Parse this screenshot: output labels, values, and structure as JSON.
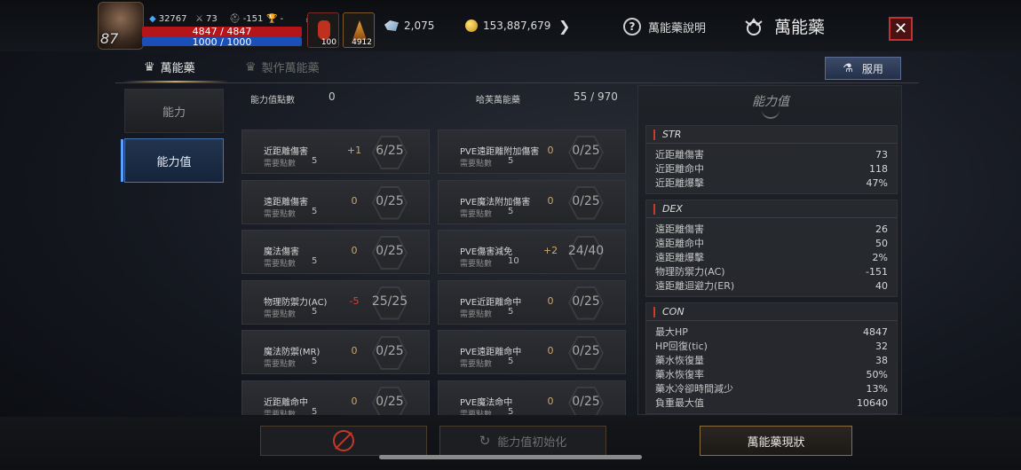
{
  "header": {
    "level": "87",
    "stat_ac": "32767",
    "stat_atk": "73",
    "stat_def": "-151",
    "stat_trophy": "-",
    "hp_text": "4847 / 4847",
    "mp_text": "1000 / 1000",
    "slot1_count": "100",
    "slot2_count": "4912",
    "gems": "2,075",
    "gold": "153,887,679",
    "help_label": "萬能藥說明",
    "title": "萬能藥"
  },
  "tabs": {
    "active": "萬能藥",
    "inactive": "製作萬能藥",
    "use_button": "服用"
  },
  "sidebar": {
    "items": [
      {
        "label": "能力"
      },
      {
        "label": "能力值"
      }
    ]
  },
  "points": {
    "label": "能力值點數",
    "value": "0",
    "halpas_label": "哈芙萬能藥",
    "halpas_value": "55 / 970"
  },
  "req_label": "需要點數",
  "cards_left": [
    {
      "name": "近距離傷害",
      "req": "5",
      "bonus": "+1",
      "value": "6/25"
    },
    {
      "name": "遠距離傷害",
      "req": "5",
      "bonus": "0",
      "value": "0/25"
    },
    {
      "name": "魔法傷害",
      "req": "5",
      "bonus": "0",
      "value": "0/25"
    },
    {
      "name": "物理防禦力(AC)",
      "req": "5",
      "bonus": "-5",
      "value": "25/25"
    },
    {
      "name": "魔法防禦(MR)",
      "req": "5",
      "bonus": "0",
      "value": "0/25"
    },
    {
      "name": "近距離命中",
      "req": "5",
      "bonus": "0",
      "value": "0/25"
    }
  ],
  "cards_right": [
    {
      "name": "PVE遠距離附加傷害",
      "req": "5",
      "bonus": "0",
      "value": "0/25"
    },
    {
      "name": "PVE魔法附加傷害",
      "req": "5",
      "bonus": "0",
      "value": "0/25"
    },
    {
      "name": "PVE傷害減免",
      "req": "10",
      "bonus": "+2",
      "value": "24/40"
    },
    {
      "name": "PVE近距離命中",
      "req": "5",
      "bonus": "0",
      "value": "0/25"
    },
    {
      "name": "PVE遠距離命中",
      "req": "5",
      "bonus": "0",
      "value": "0/25"
    },
    {
      "name": "PVE魔法命中",
      "req": "5",
      "bonus": "0",
      "value": "0/25"
    }
  ],
  "stats_panel": {
    "title": "能力值",
    "sections": [
      {
        "name": "STR",
        "rows": [
          {
            "k": "近距離傷害",
            "v": "73"
          },
          {
            "k": "近距離命中",
            "v": "118"
          },
          {
            "k": "近距離爆擊",
            "v": "47%"
          }
        ]
      },
      {
        "name": "DEX",
        "rows": [
          {
            "k": "遠距離傷害",
            "v": "26"
          },
          {
            "k": "遠距離命中",
            "v": "50"
          },
          {
            "k": "遠距離爆擊",
            "v": "2%"
          },
          {
            "k": "物理防禦力(AC)",
            "v": "-151"
          },
          {
            "k": "遠距離迴避力(ER)",
            "v": "40"
          }
        ]
      },
      {
        "name": "CON",
        "rows": [
          {
            "k": "最大HP",
            "v": "4847"
          },
          {
            "k": "HP回復(tic)",
            "v": "32"
          },
          {
            "k": "藥水恢復量",
            "v": "38"
          },
          {
            "k": "藥水恢復率",
            "v": "50%"
          },
          {
            "k": "藥水冷卻時間減少",
            "v": "13%"
          },
          {
            "k": "負重最大值",
            "v": "10640"
          }
        ]
      }
    ]
  },
  "bottom": {
    "reset_label": "能力值初始化",
    "status_label": "萬能藥現狀"
  },
  "colors": {
    "bonus_positive": "#c9a86a",
    "bonus_negative": "#d2443a",
    "bonus_zero": "#c9a86a"
  }
}
